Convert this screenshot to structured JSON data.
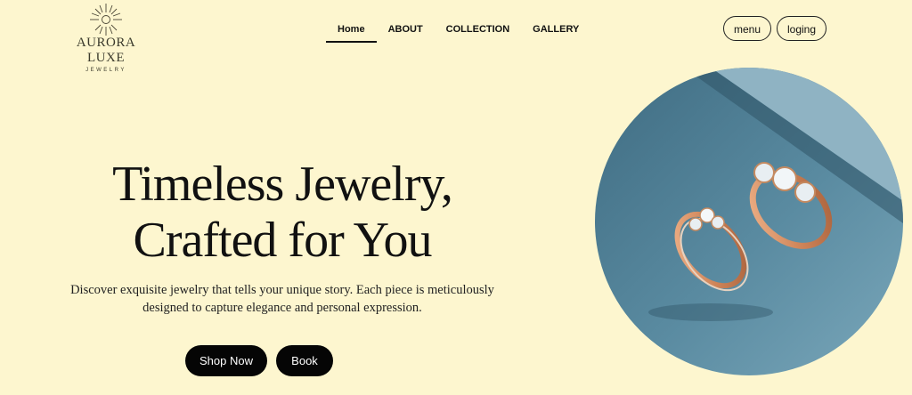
{
  "brand": {
    "name": "AURORA LUXE",
    "sub": "JEWELRY"
  },
  "nav": {
    "items": [
      {
        "label": "Home",
        "active": true
      },
      {
        "label": "ABOUT"
      },
      {
        "label": "COLLECTION"
      },
      {
        "label": "GALLERY"
      }
    ]
  },
  "header_buttons": {
    "menu": "menu",
    "login": "loging"
  },
  "hero": {
    "title_line1": "Timeless Jewelry,",
    "title_line2": "Crafted for You",
    "text_line1": "Discover exquisite jewelry that tells your unique story. Each piece is meticulously",
    "text_line2": "designed to capture elegance and personal expression.",
    "shop_label": "Shop Now",
    "book_label": "Book"
  },
  "colors": {
    "background": "#fdf6cf",
    "button": "#050505",
    "photo_backdrop": "#4f7e94",
    "rose_gold": "#d9936a"
  },
  "icons": {
    "logo": "sun-burst-icon"
  }
}
